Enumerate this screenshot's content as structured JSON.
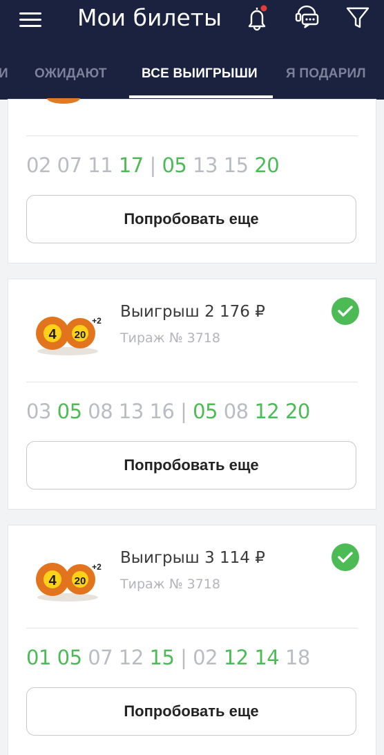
{
  "header": {
    "title": "Мои билеты",
    "icons": [
      "menu-icon",
      "bell-icon",
      "support-chat-icon",
      "filter-icon"
    ],
    "notification_dot_color": "#e63b3b"
  },
  "tabs": [
    {
      "label": "И"
    },
    {
      "label": "ОЖИДАЮТ"
    },
    {
      "label": "ВСЕ ВЫИГРЫШИ",
      "active": true
    },
    {
      "label": "Я ПОДАРИЛ"
    }
  ],
  "cards": [
    {
      "numbers": [
        {
          "t": "02 07 11 ",
          "win": false
        },
        {
          "t": "17",
          "win": true
        },
        {
          "t": " | ",
          "win": false
        },
        {
          "t": "05",
          "win": true
        },
        {
          "t": " 13 15 ",
          "win": false
        },
        {
          "t": "20",
          "win": true
        }
      ],
      "button": "Попробовать еще"
    },
    {
      "logo": {
        "main": "4",
        "secondary": "20",
        "badge": "+2"
      },
      "win_title": "Выигрыш 2 176 ₽",
      "draw": "Тираж № 3718",
      "numbers": [
        {
          "t": "03 ",
          "win": false
        },
        {
          "t": "05",
          "win": true
        },
        {
          "t": " 08 13 16 | ",
          "win": false
        },
        {
          "t": "05",
          "win": true
        },
        {
          "t": " 08 ",
          "win": false
        },
        {
          "t": "12 20",
          "win": true
        }
      ],
      "button": "Попробовать еще"
    },
    {
      "logo": {
        "main": "4",
        "secondary": "20",
        "badge": "+2"
      },
      "win_title": "Выигрыш 3 114 ₽",
      "draw": "Тираж № 3718",
      "numbers": [
        {
          "t": "01 05",
          "win": true
        },
        {
          "t": " 07 12 ",
          "win": false
        },
        {
          "t": "15",
          "win": true
        },
        {
          "t": " | 02 ",
          "win": false
        },
        {
          "t": "12 14",
          "win": true
        },
        {
          "t": " 18",
          "win": false
        }
      ],
      "button": "Попробовать еще"
    }
  ],
  "colors": {
    "accent_green": "#4cba55",
    "header_bg": "#1b2240",
    "muted_number": "#b9bcc2"
  }
}
